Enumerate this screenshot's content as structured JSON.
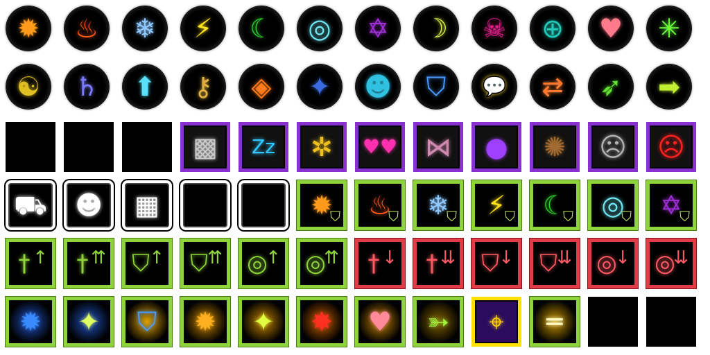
{
  "sheet": {
    "rows": [
      [
        {
          "icon": "orange-slash-burst-icon",
          "frame": "orb",
          "color": "#ff9a1a"
        },
        {
          "icon": "fire-icon",
          "frame": "orb",
          "color": "#ff5a1a"
        },
        {
          "icon": "snowflake-icon",
          "frame": "orb",
          "color": "#8ec8ff"
        },
        {
          "icon": "lightning-icon",
          "frame": "orb",
          "color": "#ffe21a"
        },
        {
          "icon": "wind-crescent-icon",
          "frame": "orb",
          "color": "#2ecc2e"
        },
        {
          "icon": "cyan-rings-icon",
          "frame": "orb",
          "color": "#6fe6f0"
        },
        {
          "icon": "pentagram-seal-icon",
          "frame": "orb",
          "color": "#a030d8"
        },
        {
          "icon": "moon-stars-icon",
          "frame": "orb",
          "color": "#d8f040"
        },
        {
          "icon": "skull-icon",
          "frame": "orb",
          "color": "#e0208a"
        },
        {
          "icon": "teal-ring-target-icon",
          "frame": "orb",
          "color": "#20c8b8"
        },
        {
          "icon": "heart-icon",
          "frame": "orb",
          "color": "#ff7a8a"
        },
        {
          "icon": "green-sparkle-icon",
          "frame": "orb",
          "color": "#6aff3a"
        }
      ],
      [
        {
          "icon": "yin-yang-swirl-icon",
          "frame": "orb",
          "color": "#e0c020"
        },
        {
          "icon": "saturn-symbol-icon",
          "frame": "orb",
          "color": "#7a7aff"
        },
        {
          "icon": "up-arrow-sparkle-icon",
          "frame": "orb",
          "color": "#5ae0ff"
        },
        {
          "icon": "key-icon",
          "frame": "orb",
          "color": "#e0b040"
        },
        {
          "icon": "orange-diamonds-icon",
          "frame": "orb",
          "color": "#ff7a1a"
        },
        {
          "icon": "blue-compass-icon",
          "frame": "orb",
          "color": "#3a6ae0"
        },
        {
          "icon": "cat-faces-icon",
          "frame": "orb",
          "color": "#30c0e0"
        },
        {
          "icon": "shield-icon",
          "frame": "orb",
          "color": "#4a9aff"
        },
        {
          "icon": "speech-bubble-icon",
          "frame": "orb",
          "color": "#ffe030"
        },
        {
          "icon": "swap-people-icon",
          "frame": "orb",
          "color": "#ff7a30"
        },
        {
          "icon": "running-man-icon",
          "frame": "orb",
          "color": "#60e030"
        },
        {
          "icon": "right-arrow-icon",
          "frame": "orb",
          "color": "#c0f030"
        }
      ],
      [
        {
          "icon": "empty-slot",
          "frame": "empty",
          "color": "#000000"
        },
        {
          "icon": "empty-slot",
          "frame": "empty",
          "color": "#000000"
        },
        {
          "icon": "empty-slot",
          "frame": "empty",
          "color": "#000000"
        },
        {
          "icon": "checker-wave-icon",
          "frame": "purple",
          "color": "#c8c8c8"
        },
        {
          "icon": "zzz-sleep-icon",
          "frame": "purple",
          "color": "#30c8ff"
        },
        {
          "icon": "tornado-stars-icon",
          "frame": "purple",
          "color": "#f0c020"
        },
        {
          "icon": "pink-hearts-icon",
          "frame": "purple",
          "color": "#ff30b0"
        },
        {
          "icon": "chain-net-icon",
          "frame": "purple",
          "color": "#d08ab0"
        },
        {
          "icon": "purple-bubbles-icon",
          "frame": "purple",
          "color": "#a040ff"
        },
        {
          "icon": "brown-splat-icon",
          "frame": "purple",
          "color": "#a06a30"
        },
        {
          "icon": "gray-person-icon",
          "frame": "purple",
          "color": "#b0b0b0"
        },
        {
          "icon": "red-person-icon",
          "frame": "purple",
          "color": "#ff2020"
        }
      ],
      [
        {
          "icon": "shopping-cart-icon",
          "frame": "white",
          "color": "#ffffff"
        },
        {
          "icon": "demon-face-icon",
          "frame": "white",
          "color": "#ffffff"
        },
        {
          "icon": "qr-grid-icon",
          "frame": "white",
          "color": "#ffffff"
        },
        {
          "icon": "blank-white-frame",
          "frame": "white",
          "color": "#000000"
        },
        {
          "icon": "blank-white-frame",
          "frame": "white",
          "color": "#000000"
        },
        {
          "icon": "slash-burst-shield-icon",
          "frame": "green",
          "color": "#ff9a1a",
          "badge": true
        },
        {
          "icon": "fire-shield-icon",
          "frame": "green",
          "color": "#ff5a1a",
          "badge": true
        },
        {
          "icon": "snowflake-shield-icon",
          "frame": "green",
          "color": "#8ec8ff",
          "badge": true
        },
        {
          "icon": "lightning-shield-icon",
          "frame": "green",
          "color": "#ffe21a",
          "badge": true
        },
        {
          "icon": "wind-shield-icon",
          "frame": "green",
          "color": "#2ecc2e",
          "badge": true
        },
        {
          "icon": "rings-shield-icon",
          "frame": "green",
          "color": "#6fe6f0",
          "badge": true
        },
        {
          "icon": "pentagram-shield-icon",
          "frame": "green",
          "color": "#a030d8",
          "badge": true
        }
      ],
      [
        {
          "icon": "attack-up-icon",
          "frame": "green",
          "color": "#8fd43a",
          "arrow": "up"
        },
        {
          "icon": "attack-up-2-icon",
          "frame": "green",
          "color": "#8fd43a",
          "arrow": "up2"
        },
        {
          "icon": "defense-up-icon",
          "frame": "green",
          "color": "#8fd43a",
          "arrow": "up"
        },
        {
          "icon": "defense-up-2-icon",
          "frame": "green",
          "color": "#8fd43a",
          "arrow": "up2"
        },
        {
          "icon": "ring-up-icon",
          "frame": "green",
          "color": "#8fd43a",
          "arrow": "up"
        },
        {
          "icon": "ring-up-2-icon",
          "frame": "green",
          "color": "#8fd43a",
          "arrow": "up2"
        },
        {
          "icon": "attack-down-icon",
          "frame": "red",
          "color": "#ff5a64",
          "arrow": "down"
        },
        {
          "icon": "attack-down-2-icon",
          "frame": "red",
          "color": "#ff5a64",
          "arrow": "down2"
        },
        {
          "icon": "defense-down-icon",
          "frame": "red",
          "color": "#ff5a64",
          "arrow": "down"
        },
        {
          "icon": "defense-down-2-icon",
          "frame": "red",
          "color": "#ff5a64",
          "arrow": "down2"
        },
        {
          "icon": "ring-down-icon",
          "frame": "red",
          "color": "#ff5a64",
          "arrow": "down"
        },
        {
          "icon": "ring-down-2-icon",
          "frame": "red",
          "color": "#ff5a64",
          "arrow": "down2"
        }
      ],
      [
        {
          "icon": "blue-burst-orb-icon",
          "frame": "green",
          "color": "#3a8aff",
          "glow": "#2050c0"
        },
        {
          "icon": "blue-sparkle-orb-icon",
          "frame": "green",
          "color": "#e0ff60",
          "glow": "#2050c0"
        },
        {
          "icon": "golden-shield-orb-icon",
          "frame": "green",
          "color": "#4a9aff",
          "glow": "#e0a000"
        },
        {
          "icon": "radiant-burst-icon",
          "frame": "green",
          "color": "#ffb020",
          "glow": "#c08000"
        },
        {
          "icon": "radiant-sparkle-icon",
          "frame": "green",
          "color": "#e0ff40",
          "glow": "#c08000"
        },
        {
          "icon": "explosion-icon",
          "frame": "green",
          "color": "#ff3020",
          "glow": "#c06000"
        },
        {
          "icon": "radiant-heart-icon",
          "frame": "green",
          "color": "#ff8a9a",
          "glow": "#c08000"
        },
        {
          "icon": "arrow-aura-icon",
          "frame": "green",
          "color": "#a0f040",
          "glow": "#806000"
        },
        {
          "icon": "crosshair-burst-icon",
          "frame": "yellow",
          "color": "#ffd000"
        },
        {
          "icon": "golden-beam-icon",
          "frame": "green",
          "color": "#fff8c0",
          "glow": "#c09000"
        },
        {
          "icon": "empty-slot",
          "frame": "empty",
          "color": "#000000"
        },
        {
          "icon": "empty-slot",
          "frame": "empty",
          "color": "#000000"
        }
      ]
    ]
  }
}
